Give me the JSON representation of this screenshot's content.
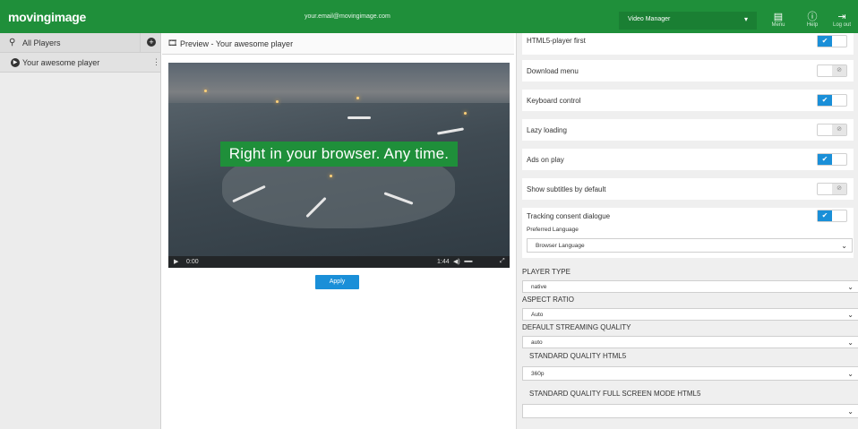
{
  "topbar": {
    "logo": "movingimage",
    "email": "your.email@movingimage.com",
    "manager_select": "Video Manager",
    "buttons": [
      {
        "label": "Menu",
        "icon": "menu-icon"
      },
      {
        "label": "Help",
        "icon": "help-icon"
      },
      {
        "label": "Log out",
        "icon": "logout-icon"
      }
    ]
  },
  "sidebar": {
    "header": "All Players",
    "items": [
      {
        "label": "Your awesome player"
      }
    ]
  },
  "preview": {
    "title": "Preview - Your awesome player",
    "banner": "Right in your browser. Any time.",
    "time_current": "0:00",
    "time_total": "1:44",
    "apply_label": "Apply"
  },
  "settings": {
    "toggles": [
      {
        "label": "HTML5-player first",
        "on": true
      },
      {
        "label": "Download menu",
        "on": false
      },
      {
        "label": "Keyboard control",
        "on": true
      },
      {
        "label": "Lazy loading",
        "on": false
      },
      {
        "label": "Ads on play",
        "on": true
      },
      {
        "label": "Show subtitles by default",
        "on": false
      },
      {
        "label": "Tracking consent dialogue",
        "on": true
      }
    ],
    "preferred_language_label": "Preferred Language",
    "preferred_language_value": "Browser Language",
    "player_type_label": "PLAYER TYPE",
    "player_type_value": "native",
    "aspect_ratio_label": "ASPECT RATIO",
    "aspect_ratio_value": "Auto",
    "default_quality_label": "DEFAULT STREAMING QUALITY",
    "default_quality_value": "auto",
    "standard_quality_label": "STANDARD QUALITY HTML5",
    "standard_quality_value": "360p",
    "fullscreen_quality_label": "STANDARD QUALITY FULL SCREEN MODE HTML5",
    "fullscreen_quality_value": ""
  },
  "colors": {
    "brand_green": "#1f8f3a",
    "accent_blue": "#1a8fd8"
  }
}
